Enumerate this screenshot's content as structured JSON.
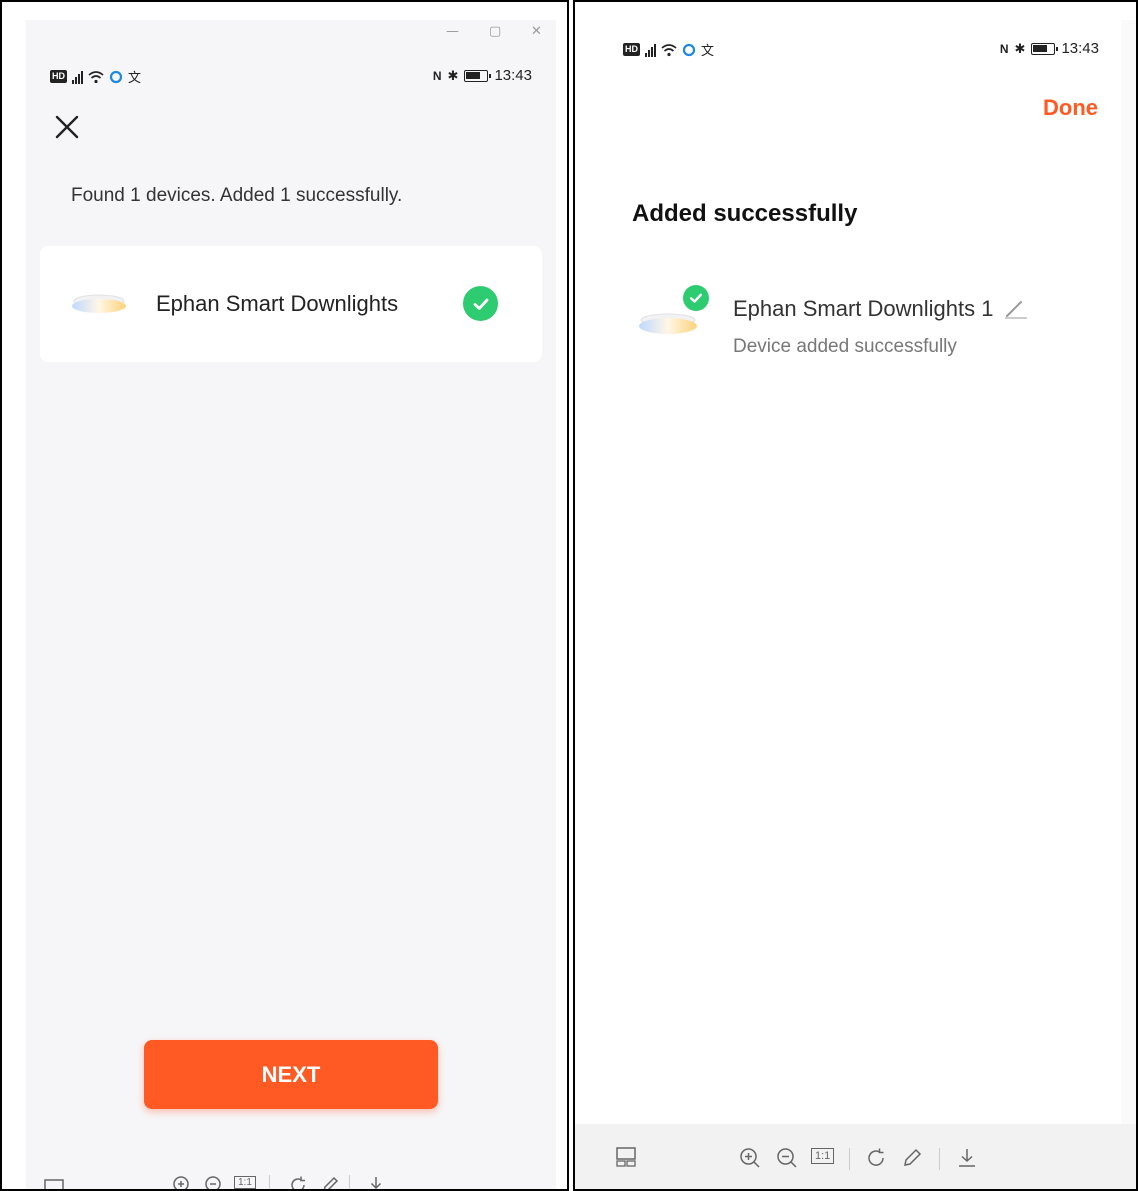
{
  "left": {
    "status_time": "13:43",
    "found_message": "Found 1 devices. Added 1 successfully.",
    "device_name": "Ephan Smart Downlights",
    "next_label": "NEXT",
    "toolbar": {
      "fit_label": "1:1"
    }
  },
  "right": {
    "status_time": "13:43",
    "done_label": "Done",
    "title": "Added successfully",
    "device_name": "Ephan Smart Downlights 1",
    "device_status": "Device added successfully",
    "toolbar": {
      "fit_label": "1:1"
    }
  },
  "colors": {
    "accent": "#ff5a24",
    "success": "#2ecc71"
  },
  "icons": [
    "close-icon",
    "check-icon",
    "edit-icon",
    "downlight-icon",
    "zoom-in-icon",
    "zoom-out-icon",
    "rotate-icon",
    "pen-icon",
    "download-icon",
    "layout-icon",
    "window-minimize-icon",
    "window-maximize-icon",
    "window-close-icon",
    "signal-icon",
    "wifi-icon",
    "bluetooth-icon",
    "nfc-icon",
    "battery-icon"
  ]
}
